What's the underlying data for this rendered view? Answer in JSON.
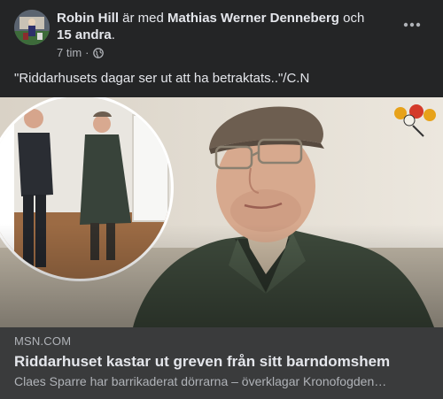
{
  "post": {
    "author": "Robin Hill",
    "connector": " är med ",
    "tagged": "Mathias Werner Denneberg",
    "and_word": " och",
    "others": "15 andra",
    "period": ".",
    "time": "7 tim",
    "dot": "·",
    "privacy_icon": "globe-icon",
    "more_icon": "more-options-icon",
    "text": "\"Riddarhusets dagar ser ut att ha betraktats..\"/C.N"
  },
  "link": {
    "domain": "MSN.COM",
    "headline": "Riddarhuset kastar ut greven från sitt barndomshem",
    "description": "Claes Sparre har barrikaderat dörrarna – överklagar Kronofogden…"
  },
  "colors": {
    "background": "#242526",
    "link_bar": "#3a3b3c",
    "primary_text": "#e4e6eb",
    "secondary_text": "#b0b3b8"
  }
}
